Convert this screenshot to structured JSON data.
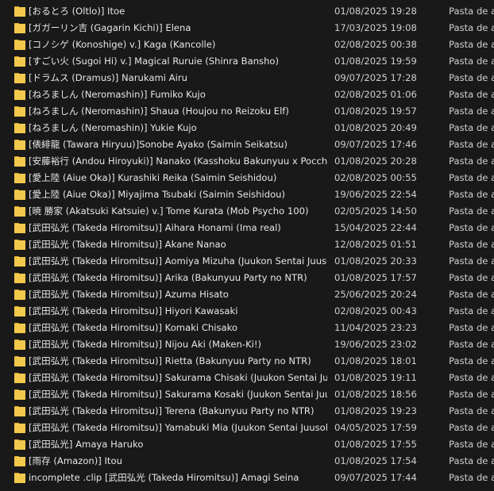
{
  "colors": {
    "background": "#191919",
    "text": "#e6e6e6",
    "folder": "#f2c94c",
    "folder_dark": "#d8a92a"
  },
  "rows": [
    {
      "name": "[おるとろ (Oltlo)] Itoe",
      "date": "01/08/2025 19:28",
      "type": "Pasta de ar"
    },
    {
      "name": "[ガガーリン吉 (Gagarin Kichi)] Elena",
      "date": "17/03/2025 19:08",
      "type": "Pasta de ar"
    },
    {
      "name": "[コノシゲ (Konoshige) v.] Kaga (Kancolle)",
      "date": "02/08/2025 00:38",
      "type": "Pasta de ar"
    },
    {
      "name": "[すごい火 (Sugoi Hi) v.] Magical Ruruie (Shinra Bansho)",
      "date": "01/08/2025 19:59",
      "type": "Pasta de ar"
    },
    {
      "name": "[ドラムス (Dramus)] Narukami Airu",
      "date": "09/07/2025 17:28",
      "type": "Pasta de ar"
    },
    {
      "name": "[ねろましん (Neromashin)] Fumiko Kujo",
      "date": "02/08/2025 01:06",
      "type": "Pasta de ar"
    },
    {
      "name": "[ねろましん (Neromashin)] Shaua (Houjou no Reizoku Elf)",
      "date": "01/08/2025 19:57",
      "type": "Pasta de ar"
    },
    {
      "name": "[ねろましん (Neromashin)] Yukie Kujo",
      "date": "01/08/2025 20:49",
      "type": "Pasta de ar"
    },
    {
      "name": "[俵緋龍 (Tawara Hiryuu)]Sonobe Ayako (Saimin Seikatsu)",
      "date": "09/07/2025 17:46",
      "type": "Pasta de ar"
    },
    {
      "name": "[安藤裕行 (Andou Hiroyuki)] Nanako (Kasshoku Bakunyuu x Poccha...",
      "date": "01/08/2025 20:28",
      "type": "Pasta de ar"
    },
    {
      "name": "[愛上陸 (Aiue Oka)] Kurashiki Reika (Saimin Seishidou)",
      "date": "02/08/2025 00:55",
      "type": "Pasta de ar"
    },
    {
      "name": "[愛上陸 (Aiue Oka)] Miyajima Tsubaki (Saimin Seishidou)",
      "date": "19/06/2025 22:54",
      "type": "Pasta de ar"
    },
    {
      "name": "[暁 勝家 (Akatsuki Katsuie) v.] Tome Kurata (Mob Psycho 100)",
      "date": "02/05/2025 14:50",
      "type": "Pasta de ar"
    },
    {
      "name": "[武田弘光 (Takeda Hiromitsu)] Aihara Honami (Ima real)",
      "date": "15/04/2025 22:44",
      "type": "Pasta de ar"
    },
    {
      "name": "[武田弘光 (Takeda Hiromitsu)] Akane Nanao",
      "date": "12/08/2025 01:51",
      "type": "Pasta de ar"
    },
    {
      "name": "[武田弘光 (Takeda Hiromitsu)] Aomiya Mizuha (Juukon Sentai Juusol...",
      "date": "01/08/2025 20:33",
      "type": "Pasta de ar"
    },
    {
      "name": "[武田弘光 (Takeda Hiromitsu)] Arika (Bakunyuu Party no NTR)",
      "date": "01/08/2025 17:57",
      "type": "Pasta de ar"
    },
    {
      "name": "[武田弘光 (Takeda Hiromitsu)] Azuma Hisato",
      "date": "25/06/2025 20:24",
      "type": "Pasta de ar"
    },
    {
      "name": "[武田弘光 (Takeda Hiromitsu)] Hiyori Kawasaki",
      "date": "02/08/2025 00:43",
      "type": "Pasta de ar"
    },
    {
      "name": "[武田弘光 (Takeda Hiromitsu)] Komaki Chisako",
      "date": "11/04/2025 23:23",
      "type": "Pasta de ar"
    },
    {
      "name": "[武田弘光 (Takeda Hiromitsu)] Nijou Aki (Maken-Ki!)",
      "date": "19/06/2025 23:02",
      "type": "Pasta de ar"
    },
    {
      "name": "[武田弘光 (Takeda Hiromitsu)] Rietta (Bakunyuu Party no NTR)",
      "date": "01/08/2025 18:01",
      "type": "Pasta de ar"
    },
    {
      "name": "[武田弘光 (Takeda Hiromitsu)] Sakurama Chisaki (Juukon Sentai Juus...",
      "date": "01/08/2025 19:11",
      "type": "Pasta de ar"
    },
    {
      "name": "[武田弘光 (Takeda Hiromitsu)] Sakurama Kosaki (Juukon Sentai Juus...",
      "date": "01/08/2025 18:56",
      "type": "Pasta de ar"
    },
    {
      "name": "[武田弘光 (Takeda Hiromitsu)] Terena (Bakunyuu Party no NTR)",
      "date": "01/08/2025 19:23",
      "type": "Pasta de ar"
    },
    {
      "name": "[武田弘光 (Takeda Hiromitsu)] Yamabuki Mia (Juukon Sentai Juusold...",
      "date": "04/05/2025 17:59",
      "type": "Pasta de ar"
    },
    {
      "name": "[武田弘光] Amaya Haruko",
      "date": "01/08/2025 17:55",
      "type": "Pasta de ar"
    },
    {
      "name": "[雨存 (Amazon)] Itou",
      "date": "01/08/2025 17:54",
      "type": "Pasta de ar"
    },
    {
      "name": "incomplete .clip [武田弘光 (Takeda Hiromitsu)] Amagi Seina",
      "date": "09/07/2025 17:44",
      "type": "Pasta de ar"
    }
  ]
}
